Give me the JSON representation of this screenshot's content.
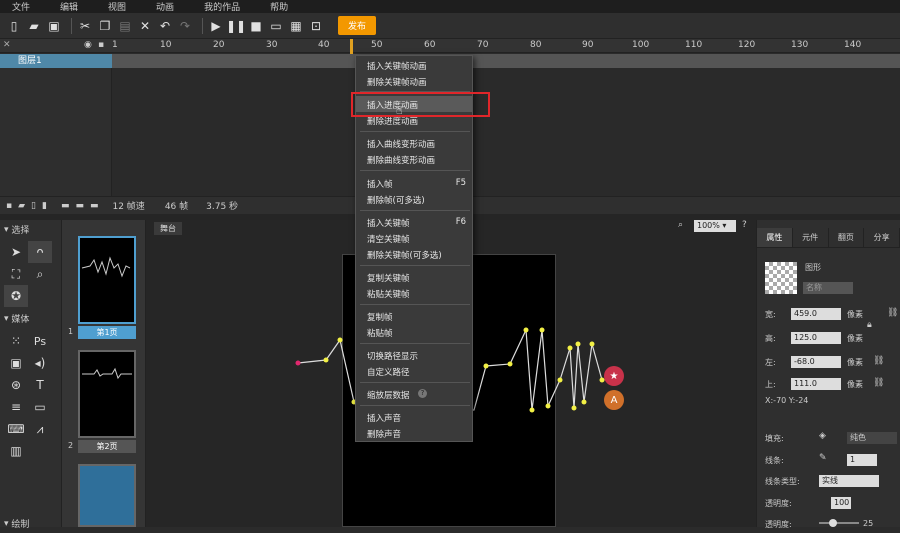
{
  "menubar": [
    "文件",
    "编辑",
    "视图",
    "动画",
    "我的作品",
    "帮助"
  ],
  "toolbar": {
    "publish_label": "发布"
  },
  "timeline": {
    "ruler": [
      "1",
      "10",
      "20",
      "30",
      "40",
      "50",
      "60",
      "70",
      "80",
      "90",
      "100",
      "110",
      "120",
      "130",
      "140"
    ],
    "layer_name": "图层1",
    "fps_label": "12 帧速",
    "frames_label": "46 帧",
    "time_label": "3.75 秒"
  },
  "tools": {
    "select_section": "选择",
    "media_section": "媒体",
    "draw_section": "绘制"
  },
  "pages": [
    {
      "num": "1",
      "label": "第1页"
    },
    {
      "num": "2",
      "label": "第2页"
    }
  ],
  "stage": {
    "tab_label": "舞台",
    "zoom": "100%"
  },
  "right_panel": {
    "tabs": [
      "属性",
      "元件",
      "翻页",
      "分享"
    ],
    "shape_label": "图形",
    "name_placeholder": "名称",
    "width_label": "宽:",
    "width_value": "459.0",
    "height_label": "高:",
    "height_value": "125.0",
    "left_label": "左:",
    "left_value": "-68.0",
    "top_label": "上:",
    "top_value": "111.0",
    "unit": "像素",
    "coords": "X:-70   Y:-24",
    "fill_label": "填充:",
    "fill_value": "纯色",
    "stroke_label": "线条:",
    "stroke_value": "1",
    "stroke_type_label": "线条类型:",
    "stroke_type_value": "实线",
    "opacity_label": "透明度:",
    "opacity_value": "100",
    "opacity2_label": "透明度:",
    "opacity2_value": "25"
  },
  "context_menu": {
    "items": [
      {
        "label": "插入关键帧动画",
        "shortcut": ""
      },
      {
        "label": "删除关键帧动画",
        "shortcut": ""
      },
      {
        "label": "插入进度动画",
        "shortcut": ""
      },
      {
        "label": "删除进度动画",
        "shortcut": ""
      },
      {
        "label": "插入曲线变形动画",
        "shortcut": ""
      },
      {
        "label": "删除曲线变形动画",
        "shortcut": ""
      },
      {
        "label": "插入帧",
        "shortcut": "F5"
      },
      {
        "label": "删除帧(可多选)",
        "shortcut": ""
      },
      {
        "label": "插入关键帧",
        "shortcut": "F6"
      },
      {
        "label": "清空关键帧",
        "shortcut": ""
      },
      {
        "label": "删除关键帧(可多选)",
        "shortcut": ""
      },
      {
        "label": "复制关键帧",
        "shortcut": ""
      },
      {
        "label": "粘贴关键帧",
        "shortcut": ""
      },
      {
        "label": "复制帧",
        "shortcut": ""
      },
      {
        "label": "粘贴帧",
        "shortcut": ""
      },
      {
        "label": "切换路径显示",
        "shortcut": ""
      },
      {
        "label": "自定义路径",
        "shortcut": ""
      },
      {
        "label": "缩放层数据",
        "shortcut": ""
      },
      {
        "label": "插入声音",
        "shortcut": ""
      },
      {
        "label": "删除声音",
        "shortcut": ""
      }
    ]
  },
  "colors": {
    "accent": "#4f9fd0",
    "publish": "#f39800",
    "highlight": "#e0262a"
  }
}
